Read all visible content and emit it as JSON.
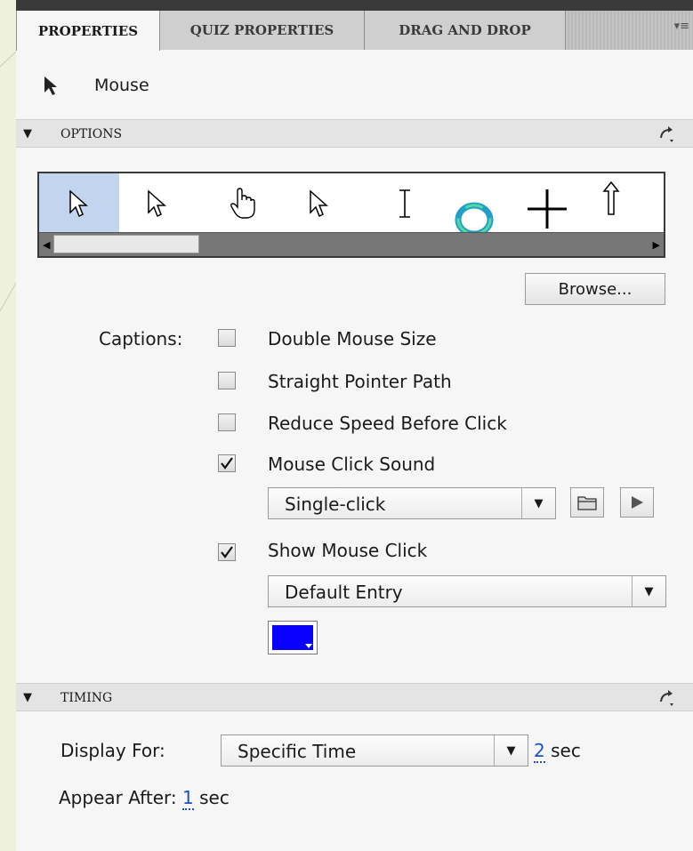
{
  "colors": {
    "click_color": "#0a00ff",
    "selected_cursor_bg": "#c3d5ee",
    "link": "#1a4fd0"
  },
  "tabs": [
    {
      "label": "PROPERTIES",
      "active": true
    },
    {
      "label": "QUIZ PROPERTIES",
      "active": false
    },
    {
      "label": "DRAG AND DROP",
      "active": false
    }
  ],
  "tab_menu_icon": "panel-menu-icon",
  "object": {
    "icon": "arrow-pointer-icon",
    "label": "Mouse"
  },
  "options": {
    "header": "OPTIONS",
    "cursors": [
      "arrow-pointer",
      "arrow-pointer",
      "hand-pointer",
      "arrow-pointer",
      "text-beam",
      "busy-ring",
      "crosshair",
      "up-arrow"
    ],
    "selected_cursor_index": 0,
    "browse_label": "Browse...",
    "captions_label": "Captions:",
    "checkboxes": [
      {
        "label": "Double Mouse Size",
        "checked": false
      },
      {
        "label": "Straight Pointer Path",
        "checked": false
      },
      {
        "label": "Reduce Speed Before Click",
        "checked": false
      },
      {
        "label": "Mouse Click Sound",
        "checked": true
      }
    ],
    "sound_select": "Single-click",
    "show_click": {
      "label": "Show Mouse Click",
      "checked": true
    },
    "click_select": "Default Entry"
  },
  "timing": {
    "header": "TIMING",
    "display_for_label": "Display For:",
    "display_for_select": "Specific Time",
    "duration_value": "2",
    "duration_unit": "sec",
    "appear_after_label": "Appear After:",
    "appear_after_value": "1",
    "appear_after_unit": "sec"
  }
}
